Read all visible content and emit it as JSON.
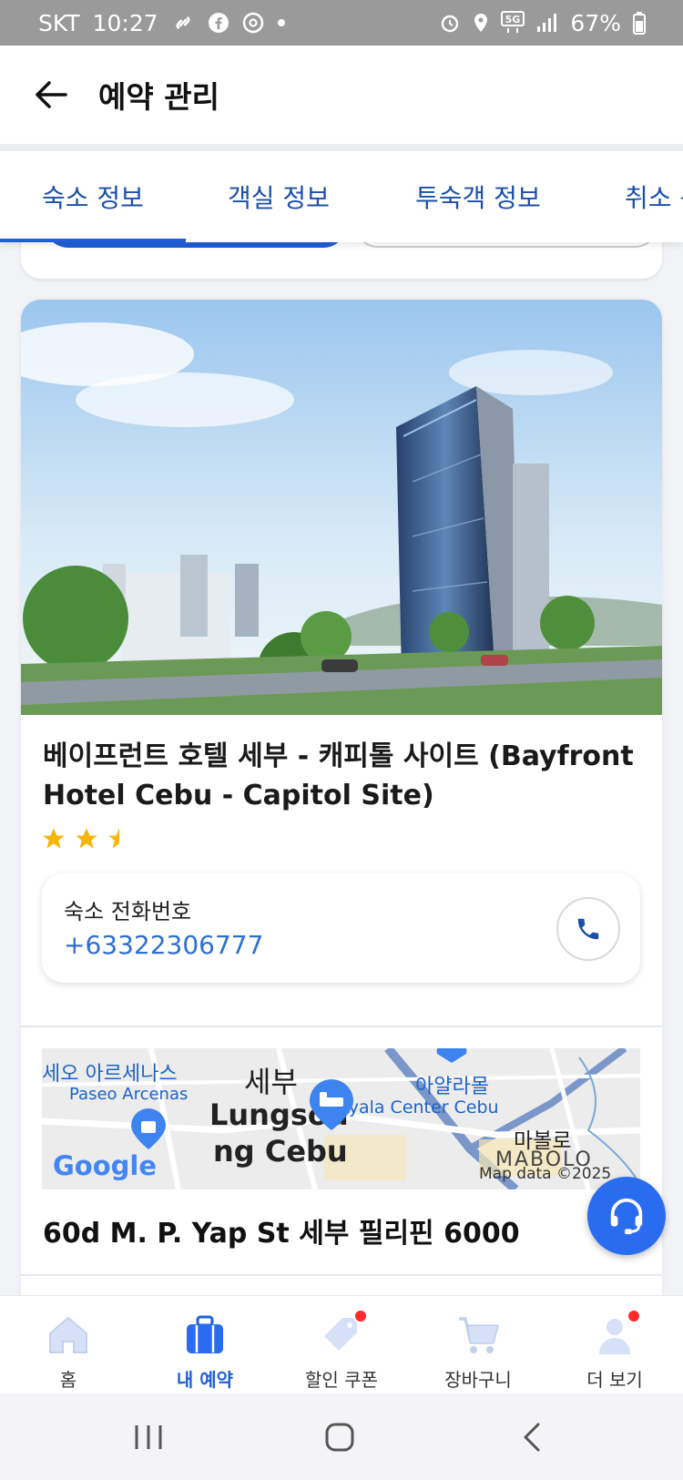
{
  "status_bar": {
    "carrier": "SKT",
    "time": "10:27",
    "network": "5G",
    "battery": "67%"
  },
  "header": {
    "title": "예약 관리"
  },
  "tabs": [
    {
      "label": "숙소 정보",
      "active": true
    },
    {
      "label": "객실 정보",
      "active": false
    },
    {
      "label": "투숙객 정보",
      "active": false
    },
    {
      "label": "취소 규",
      "active": false
    }
  ],
  "hotel": {
    "name": "베이프런트 호텔 세부 - 캐피톨 사이트 (Bayfront Hotel Cebu - Capitol Site)",
    "star_rating": 2.5,
    "phone_label": "숙소 전화번호",
    "phone_number": "+63322306777",
    "address": "60d M. P. Yap St 세부 필리핀 6000"
  },
  "map": {
    "labels": {
      "paseo_ko": "세오 아르세나스",
      "paseo_en": "Paseo Arcenas",
      "cebu_ko": "세부",
      "lungsod": "Lungsod",
      "ng_cebu": "ng Cebu",
      "ayala_ko": "아얄라몰",
      "ayala_en": "Ayala Center Cebu",
      "mabolo_ko": "마볼로",
      "mabolo_en": "MABOLO",
      "google": "Google",
      "map_data": "Map data ©2025"
    }
  },
  "bottom_nav": [
    {
      "label": "홈",
      "icon": "home-icon",
      "active": false,
      "badge": false
    },
    {
      "label": "내 예약",
      "icon": "suitcase-icon",
      "active": true,
      "badge": false
    },
    {
      "label": "할인 쿠폰",
      "icon": "coupon-tag-icon",
      "active": false,
      "badge": true
    },
    {
      "label": "장바구니",
      "icon": "cart-icon",
      "active": false,
      "badge": false
    },
    {
      "label": "더 보기",
      "icon": "profile-icon",
      "active": false,
      "badge": true
    }
  ],
  "colors": {
    "accent": "#1e5fd8",
    "tab_text": "#1c4fa8",
    "phone_link": "#2f6fd0",
    "badge": "#ff2a2a",
    "star": "#f5b50a"
  }
}
